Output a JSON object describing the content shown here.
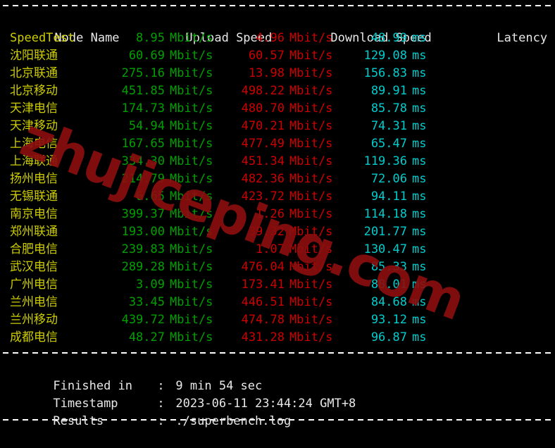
{
  "terminal": {
    "columns": {
      "node_name": "Node Name",
      "upload_speed": "Upload Speed",
      "download_speed": "Download Speed",
      "latency": "Latency"
    },
    "units": {
      "speed": "Mbit/s",
      "latency": "ms"
    },
    "colors": {
      "background": "#000000",
      "header_text": "#e8e8e8",
      "node_name": "#cdcd00",
      "upload": "#00a000",
      "download": "#cd0000",
      "latency": "#00cdcd",
      "watermark": "#8b0f0f"
    },
    "rows": [
      {
        "node": "SpeedTest",
        "upload": "8.95",
        "download": "4.96",
        "latency": "48.99"
      },
      {
        "node": "沈阳联通",
        "upload": "60.69",
        "download": "60.57",
        "latency": "129.08"
      },
      {
        "node": "北京联通",
        "upload": "275.16",
        "download": "13.98",
        "latency": "156.83"
      },
      {
        "node": "北京移动",
        "upload": "451.85",
        "download": "498.22",
        "latency": "89.91"
      },
      {
        "node": "天津电信",
        "upload": "174.73",
        "download": "480.70",
        "latency": "85.78"
      },
      {
        "node": "天津移动",
        "upload": "54.94",
        "download": "470.21",
        "latency": "74.31"
      },
      {
        "node": "上海电信",
        "upload": "167.65",
        "download": "477.49",
        "latency": "65.47"
      },
      {
        "node": "上海联通",
        "upload": "334.30",
        "download": "451.34",
        "latency": "119.36"
      },
      {
        "node": "扬州电信",
        "upload": "214.79",
        "download": "482.36",
        "latency": "72.06"
      },
      {
        "node": "无锡联通",
        "upload": "6.65",
        "download": "423.72",
        "latency": "94.11"
      },
      {
        "node": "南京电信",
        "upload": "399.37",
        "download": "1.26",
        "latency": "114.18"
      },
      {
        "node": "郑州联通",
        "upload": "193.00",
        "download": "39.32",
        "latency": "201.77"
      },
      {
        "node": "合肥电信",
        "upload": "239.83",
        "download": "1.07",
        "latency": "130.47"
      },
      {
        "node": "武汉电信",
        "upload": "289.28",
        "download": "476.04",
        "latency": "85.33"
      },
      {
        "node": "广州电信",
        "upload": "3.09",
        "download": "173.41",
        "latency": "88.01"
      },
      {
        "node": "兰州电信",
        "upload": "33.45",
        "download": "446.51",
        "latency": "84.68"
      },
      {
        "node": "兰州移动",
        "upload": "439.72",
        "download": "474.78",
        "latency": "93.12"
      },
      {
        "node": "成都电信",
        "upload": "48.27",
        "download": "431.28",
        "latency": "96.87"
      }
    ],
    "summary": [
      {
        "label": "Finished in",
        "separator": ":",
        "value": "9 min 54 sec"
      },
      {
        "label": "Timestamp",
        "separator": ":",
        "value": "2023-06-11 23:44:24 GMT+8"
      },
      {
        "label": "Results",
        "separator": ":",
        "value": "./superbench.log"
      }
    ]
  },
  "watermark": {
    "text": "zhujiceping.com"
  }
}
